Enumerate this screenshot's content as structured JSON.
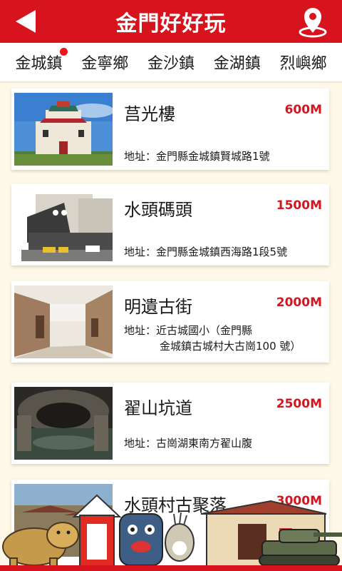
{
  "header": {
    "title": "金門好好玩",
    "back_icon": "back-arrow-icon",
    "pin_icon": "map-pin-icon"
  },
  "tabs": [
    {
      "label": "金城鎮",
      "active": true
    },
    {
      "label": "金寧鄉"
    },
    {
      "label": "金沙鎮"
    },
    {
      "label": "金湖鎮"
    },
    {
      "label": "烈嶼鄉"
    }
  ],
  "places": [
    {
      "name": "莒光樓",
      "distance": "600M",
      "address_label": "地址：",
      "address": "金門縣金城鎮賢城路1號"
    },
    {
      "name": "水頭碼頭",
      "distance": "1500M",
      "address_label": "地址：",
      "address": "金門縣金城鎮西海路1段5號"
    },
    {
      "name": "明遺古街",
      "distance": "2000M",
      "address_label": "地址：",
      "address": "近古城國小（金門縣",
      "address_line2": "金城鎮古城村大古崗100 號）"
    },
    {
      "name": "翟山坑道",
      "distance": "2500M",
      "address_label": "地址：",
      "address": "古崗湖東南方翟山腹"
    },
    {
      "name": "水頭村古聚落",
      "distance": "3000M"
    }
  ],
  "colors": {
    "accent": "#d7141d",
    "background": "#fdf8e7"
  }
}
